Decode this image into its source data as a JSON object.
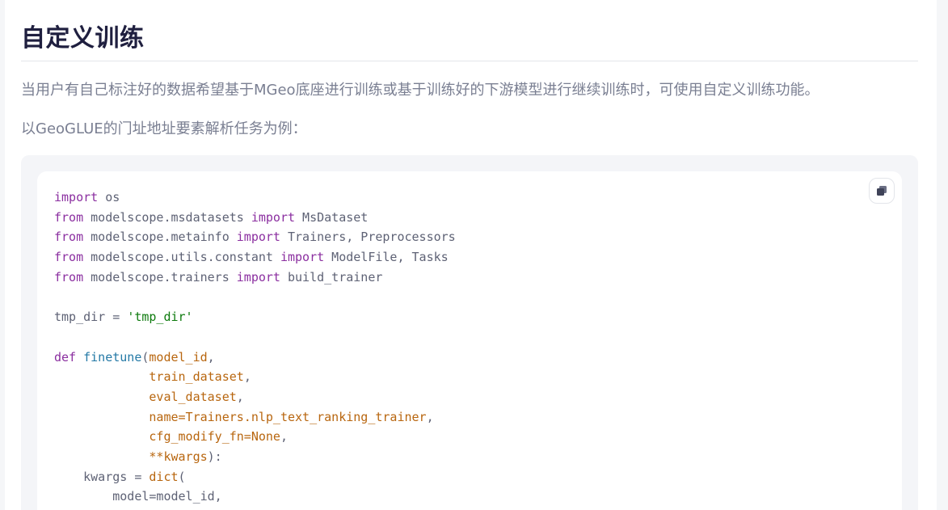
{
  "section": {
    "title": "自定义训练",
    "paragraph1": "当用户有自己标注好的数据希望基于MGeo底座进行训练或基于训练好的下游模型进行继续训练时，可使用自定义训练功能。",
    "paragraph2": "以GeoGLUE的门址地址要素解析任务为例："
  },
  "code_block": {
    "copy_icon": "copy-icon",
    "lines": [
      [
        {
          "t": "import",
          "c": "kw"
        },
        {
          "t": " os",
          "c": ""
        }
      ],
      [
        {
          "t": "from",
          "c": "kw"
        },
        {
          "t": " modelscope.msdatasets ",
          "c": ""
        },
        {
          "t": "import",
          "c": "kw"
        },
        {
          "t": " MsDataset",
          "c": ""
        }
      ],
      [
        {
          "t": "from",
          "c": "kw"
        },
        {
          "t": " modelscope.metainfo ",
          "c": ""
        },
        {
          "t": "import",
          "c": "kw"
        },
        {
          "t": " Trainers, Preprocessors",
          "c": ""
        }
      ],
      [
        {
          "t": "from",
          "c": "kw"
        },
        {
          "t": " modelscope.utils.constant ",
          "c": ""
        },
        {
          "t": "import",
          "c": "kw"
        },
        {
          "t": " ModelFile, Tasks",
          "c": ""
        }
      ],
      [
        {
          "t": "from",
          "c": "kw"
        },
        {
          "t": " modelscope.trainers ",
          "c": ""
        },
        {
          "t": "import",
          "c": "kw"
        },
        {
          "t": " build_trainer",
          "c": ""
        }
      ],
      [],
      [
        {
          "t": "tmp_dir = ",
          "c": ""
        },
        {
          "t": "'tmp_dir'",
          "c": "str"
        }
      ],
      [],
      [
        {
          "t": "def",
          "c": "kw"
        },
        {
          "t": " ",
          "c": ""
        },
        {
          "t": "finetune",
          "c": "fn"
        },
        {
          "t": "(",
          "c": ""
        },
        {
          "t": "model_id",
          "c": "prm"
        },
        {
          "t": ",",
          "c": ""
        }
      ],
      [
        {
          "t": "             ",
          "c": ""
        },
        {
          "t": "train_dataset",
          "c": "prm"
        },
        {
          "t": ",",
          "c": ""
        }
      ],
      [
        {
          "t": "             ",
          "c": ""
        },
        {
          "t": "eval_dataset",
          "c": "prm"
        },
        {
          "t": ",",
          "c": ""
        }
      ],
      [
        {
          "t": "             ",
          "c": ""
        },
        {
          "t": "name=Trainers.nlp_text_ranking_trainer",
          "c": "prm"
        },
        {
          "t": ",",
          "c": ""
        }
      ],
      [
        {
          "t": "             ",
          "c": ""
        },
        {
          "t": "cfg_modify_fn=None",
          "c": "prm"
        },
        {
          "t": ",",
          "c": ""
        }
      ],
      [
        {
          "t": "             ",
          "c": ""
        },
        {
          "t": "**kwargs",
          "c": "prm"
        },
        {
          "t": "):",
          "c": ""
        }
      ],
      [
        {
          "t": "    kwargs = ",
          "c": ""
        },
        {
          "t": "dict",
          "c": "bi"
        },
        {
          "t": "(",
          "c": ""
        }
      ],
      [
        {
          "t": "        model=model_id,",
          "c": ""
        }
      ]
    ]
  }
}
